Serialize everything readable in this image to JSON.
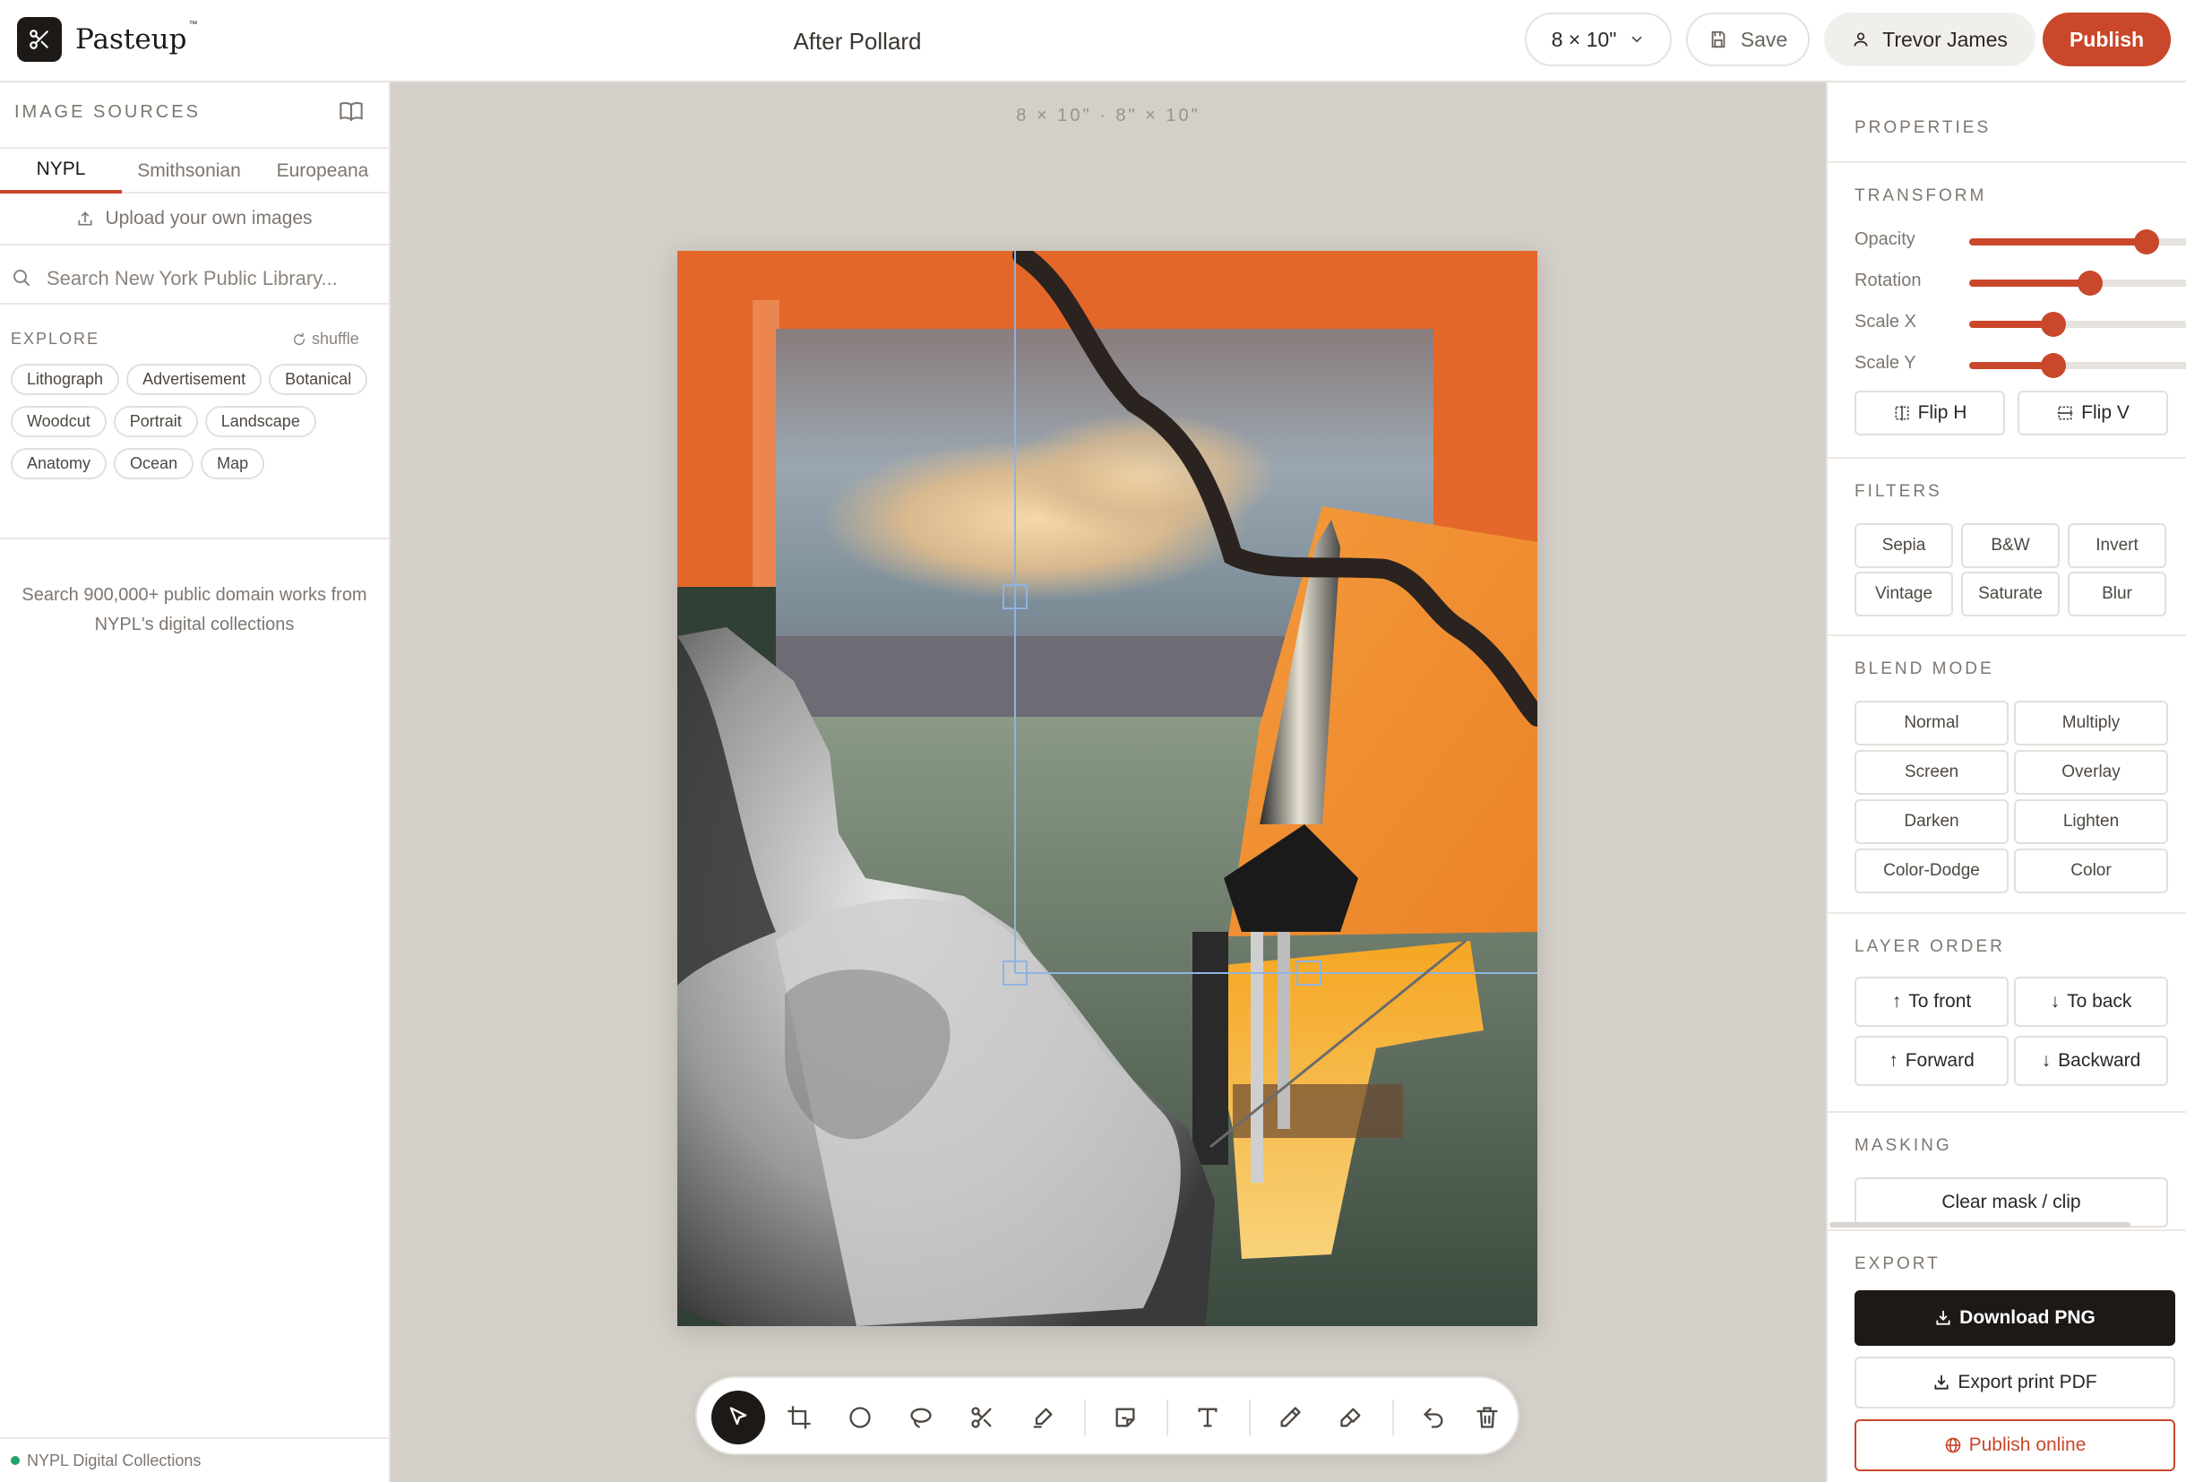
{
  "app": {
    "name": "Pasteup",
    "trademark": "™"
  },
  "header": {
    "doc_title": "After Pollard",
    "size_label": "8 × 10\"",
    "save_label": "Save",
    "user_name": "Trevor James",
    "publish_label": "Publish"
  },
  "sources": {
    "title": "IMAGE SOURCES",
    "tabs": [
      {
        "label": "NYPL",
        "active": true
      },
      {
        "label": "Smithsonian"
      },
      {
        "label": "Europeana"
      }
    ],
    "upload_label": "Upload your own images",
    "search_placeholder": "Search New York Public Library...",
    "explore_label": "EXPLORE",
    "shuffle_label": "shuffle",
    "chips": [
      "Lithograph",
      "Advertisement",
      "Botanical",
      "Woodcut",
      "Portrait",
      "Landscape",
      "Anatomy",
      "Ocean",
      "Map"
    ],
    "hint": "Search 900,000+ public domain works from NYPL's digital collections",
    "footer": "NYPL Digital Collections"
  },
  "canvas": {
    "size_note": "8 × 10\" · 8\" × 10\""
  },
  "tools": [
    "select-tool",
    "crop-tool",
    "ellipse-tool",
    "lasso-tool",
    "scissors-tool",
    "brush-tool",
    "sticker-tool",
    "text-tool",
    "pencil-tool",
    "paint-tool",
    "undo-tool",
    "delete-tool"
  ],
  "properties": {
    "title": "PROPERTIES",
    "transform": {
      "title": "TRANSFORM",
      "sliders": [
        {
          "label": "Opacity",
          "value": 0.76
        },
        {
          "label": "Rotation",
          "value": 0.52
        },
        {
          "label": "Scale X",
          "value": 0.36
        },
        {
          "label": "Scale Y",
          "value": 0.36
        }
      ],
      "flip_h": "Flip H",
      "flip_v": "Flip V"
    },
    "filters": {
      "title": "FILTERS",
      "items": [
        "Sepia",
        "B&W",
        "Invert",
        "Vintage",
        "Saturate",
        "Blur"
      ]
    },
    "blend": {
      "title": "BLEND MODE",
      "items": [
        "Normal",
        "Multiply",
        "Screen",
        "Overlay",
        "Darken",
        "Lighten",
        "Color-Dodge",
        "Color"
      ]
    },
    "layer_order": {
      "title": "LAYER ORDER",
      "to_front": "To front",
      "to_back": "To back",
      "forward": "Forward",
      "backward": "Backward"
    },
    "masking": {
      "title": "MASKING",
      "clear": "Clear mask / clip"
    },
    "export": {
      "title": "EXPORT",
      "download_png": "Download PNG",
      "print_pdf": "Export print PDF",
      "publish_online": "Publish online"
    }
  },
  "colors": {
    "accent": "#c9472b",
    "dark": "#1c1917",
    "canvas_bg": "#d4cfc9"
  }
}
